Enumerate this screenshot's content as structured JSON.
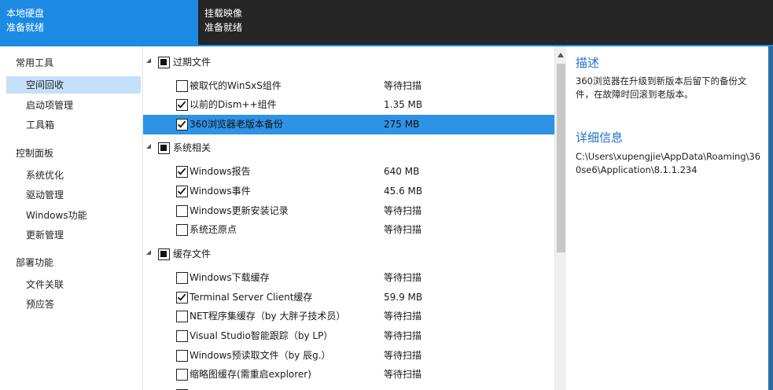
{
  "top_tabs": [
    {
      "title": "本地硬盘",
      "status": "准备就绪"
    },
    {
      "title": "挂载映像",
      "status": "准备就绪"
    }
  ],
  "sidebar": {
    "categories": [
      {
        "label": "常用工具",
        "items": [
          "空间回收",
          "启动项管理",
          "工具箱"
        ]
      },
      {
        "label": "控制面板",
        "items": [
          "系统优化",
          "驱动管理",
          "Windows功能",
          "更新管理"
        ]
      },
      {
        "label": "部署功能",
        "items": [
          "文件关联",
          "预应答"
        ]
      }
    ],
    "selected": "空间回收"
  },
  "tree": {
    "groups": [
      {
        "label": "过期文件",
        "items": [
          {
            "label": "被取代的WinSxS组件",
            "size": "等待扫描",
            "checked": false
          },
          {
            "label": "以前的Dism++组件",
            "size": "1.35 MB",
            "checked": true
          },
          {
            "label": "360浏览器老版本备份",
            "size": "275 MB",
            "checked": true,
            "selected": true
          }
        ]
      },
      {
        "label": "系统相关",
        "items": [
          {
            "label": "Windows报告",
            "size": "640 MB",
            "checked": true
          },
          {
            "label": "Windows事件",
            "size": "45.6 MB",
            "checked": true
          },
          {
            "label": "Windows更新安装记录",
            "size": "等待扫描",
            "checked": false
          },
          {
            "label": "系统还原点",
            "size": "等待扫描",
            "checked": false
          }
        ]
      },
      {
        "label": "缓存文件",
        "items": [
          {
            "label": "Windows下载缓存",
            "size": "等待扫描",
            "checked": false
          },
          {
            "label": "Terminal Server Client缓存",
            "size": "59.9 MB",
            "checked": true
          },
          {
            "label": "NET程序集缓存（by 大胖子技术员）",
            "size": "等待扫描",
            "checked": false
          },
          {
            "label": "Visual Studio智能跟踪（by LP）",
            "size": "等待扫描",
            "checked": false
          },
          {
            "label": "Windows预读取文件（by 辰g.）",
            "size": "等待扫描",
            "checked": false
          },
          {
            "label": "缩略图缓存(需重启explorer)",
            "size": "等待扫描",
            "checked": false
          }
        ]
      }
    ]
  },
  "description": {
    "heading": "描述",
    "text": "360浏览器在升级到新版本后留下的备份文件，在故障时回滚到老版本。",
    "details_heading": "详细信息",
    "details_text": "C:\\Users\\xupengjie\\AppData\\Roaming\\360se6\\Application\\8.1.1.234"
  },
  "colors": {
    "accent": "#1c8ae3",
    "selected_row": "#2e93e6",
    "nav_selected": "#c4e0fa",
    "heading": "#1c6fc4"
  }
}
